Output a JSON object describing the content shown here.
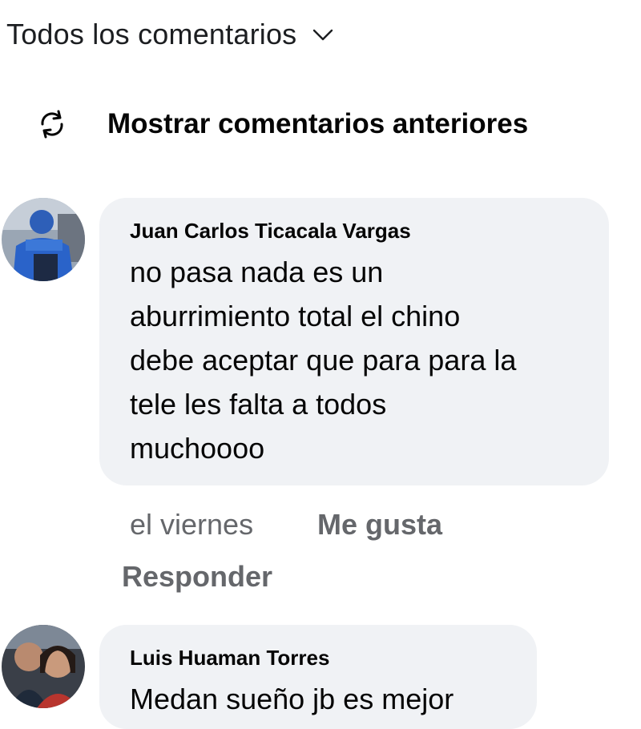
{
  "header": {
    "filter_label": "Todos los comentarios",
    "filter_icon": "chevron-down-icon"
  },
  "show_previous": {
    "label": "Mostrar comentarios anteriores",
    "icon": "refresh-icon"
  },
  "comments": [
    {
      "author": "Juan Carlos Ticacala Vargas",
      "lines": [
        "no pasa nada es un",
        "aburrimiento total el chino",
        "debe aceptar que para para la",
        "tele les falta a todos",
        "muchoooo"
      ],
      "time": "el viernes",
      "like_label": "Me gusta",
      "reply_label": "Responder"
    },
    {
      "author": "Luis Huaman Torres",
      "lines": [
        "Medan sueño jb es mejor"
      ]
    }
  ],
  "colors": {
    "bubble_bg": "#f0f2f5",
    "secondary_text": "#65676b",
    "primary_text": "#050505"
  }
}
